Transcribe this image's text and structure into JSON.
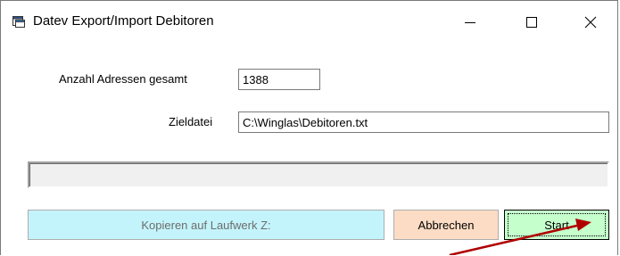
{
  "window": {
    "title": "Datev Export/Import Debitoren",
    "app_icon": "form-window-icon",
    "controls": {
      "minimize": "minimize-icon",
      "maximize": "maximize-icon",
      "close": "close-icon"
    }
  },
  "form": {
    "count_label": "Anzahl Adressen gesamt",
    "count_value": "1388",
    "target_label": "Zieldatei",
    "target_value": "C:\\Winglas\\Debitoren.txt",
    "progress": 0
  },
  "buttons": {
    "copy_label": "Kopieren auf Laufwerk Z:",
    "cancel_label": "Abbrechen",
    "start_label": "Start"
  },
  "colors": {
    "copy_button": "#c4f4fb",
    "cancel_button": "#fcdcc4",
    "start_button": "#c5ffcc",
    "annotation_arrow": "#b00000"
  },
  "annotation": {
    "type": "arrow",
    "points_to": "start-button"
  }
}
